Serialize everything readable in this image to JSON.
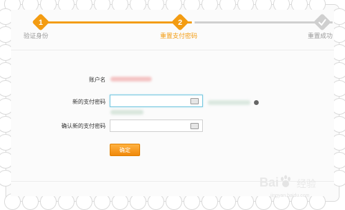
{
  "colors": {
    "accent": "#f39c12",
    "inactive": "#cfcfcf",
    "done_check": "#c8c8c8"
  },
  "steps": [
    {
      "number": "1",
      "label": "验证身份",
      "state": "done"
    },
    {
      "number": "2",
      "label": "重置支付密码",
      "state": "current"
    },
    {
      "label": "重置成功",
      "state": "pending",
      "icon": "check-icon"
    }
  ],
  "form": {
    "account_label": "账户名",
    "new_password_label": "新的支付密码",
    "confirm_password_label": "确认新的支付密码",
    "submit_label": "确定"
  },
  "watermark": {
    "logo_left": "Bai",
    "logo_right": "经验",
    "url": "jingyan.baidu.com"
  }
}
